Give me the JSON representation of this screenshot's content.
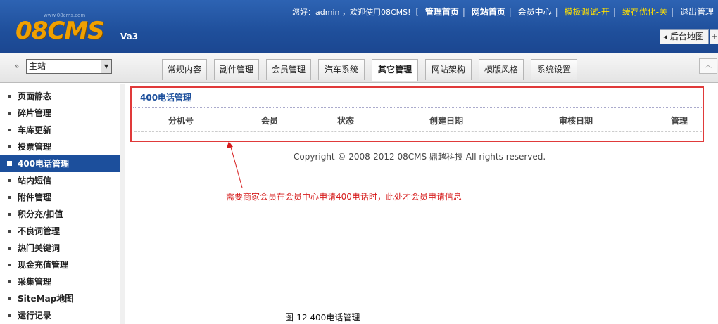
{
  "header": {
    "logo": "08CMS",
    "logo_sub": "www.08cms.com",
    "version": "Va3",
    "greeting": "您好：admin ，欢迎使用08CMS!",
    "bracket": "[",
    "links": [
      "管理首页",
      "网站首页",
      "会员中心",
      "模板调试-开",
      "缓存优化-关",
      "退出管理"
    ],
    "sitemap_button": "◂ 后台地图",
    "plus_button": "+"
  },
  "site_select": {
    "chevron": "»",
    "value": "主站"
  },
  "tabs": [
    "常规内容",
    "副件管理",
    "会员管理",
    "汽车系统",
    "其它管理",
    "网站架构",
    "模版风格",
    "系统设置"
  ],
  "active_tab": "其它管理",
  "sidebar": {
    "items": [
      "页面静态",
      "碎片管理",
      "车库更新",
      "投票管理",
      "400电话管理",
      "站内短信",
      "附件管理",
      "积分充/扣值",
      "不良词管理",
      "热门关键词",
      "现金充值管理",
      "采集管理",
      "SiteMap地图",
      "运行记录"
    ],
    "active": "400电话管理"
  },
  "panel": {
    "title": "400电话管理",
    "columns": [
      "分机号",
      "会员",
      "状态",
      "创建日期",
      "审核日期",
      "管理"
    ]
  },
  "footer": "Copyright © 2008-2012 08CMS 鼎越科技 All rights reserved.",
  "annotation": "需要商家会员在会员中心申请400电话时，此处才会员申请信息",
  "caption": "图-12 400电话管理",
  "colors": {
    "header_blue": "#1f4f9b",
    "logo_orange": "#f0a000",
    "highlight_red": "#e03a3a",
    "link_yellow": "#ffe000"
  }
}
